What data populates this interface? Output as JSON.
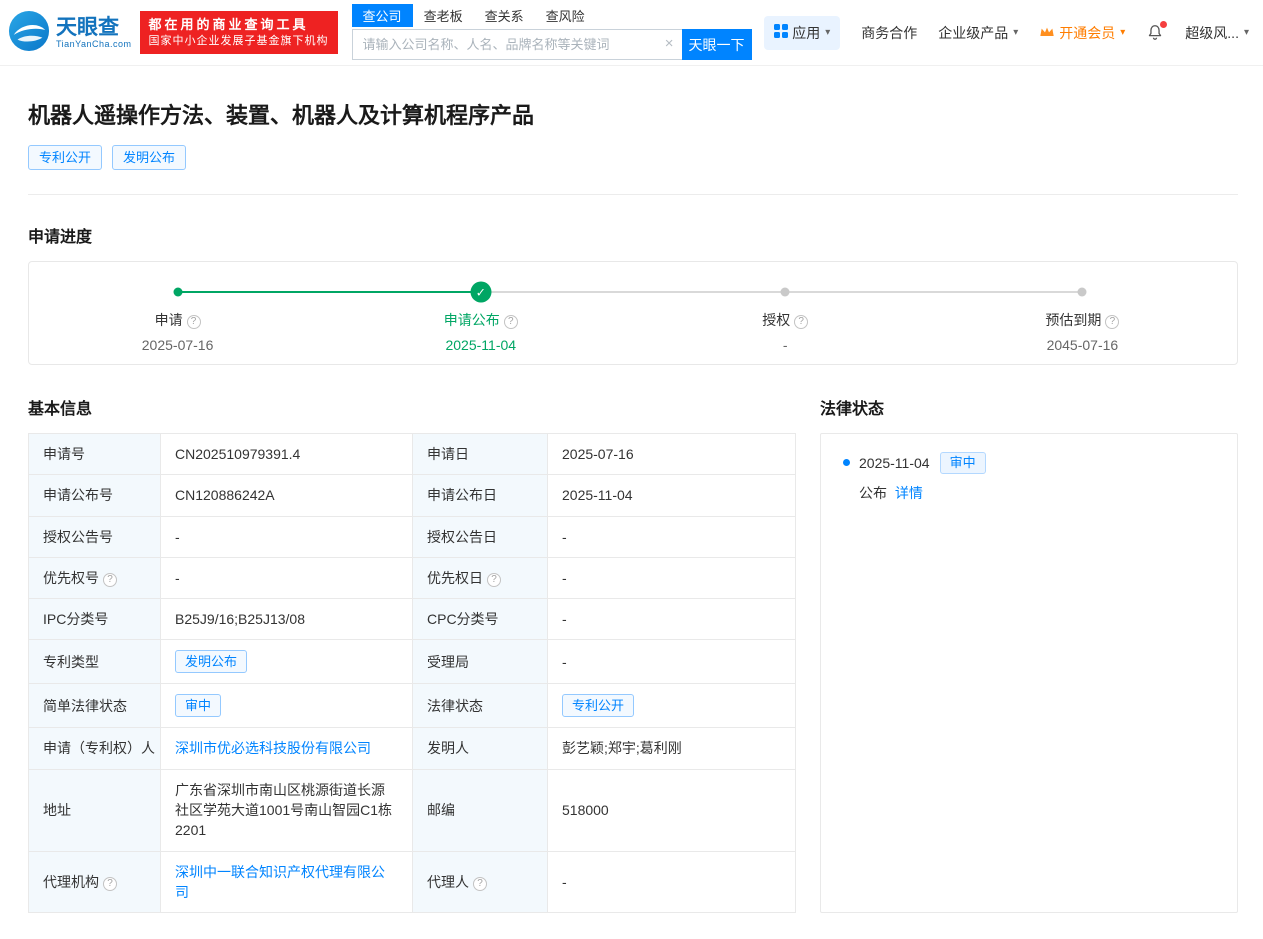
{
  "colors": {
    "brand_blue": "#0084ff",
    "green": "#00a664",
    "orange": "#ff7d00",
    "badge_red": "#ee2222"
  },
  "icons": {
    "help": "?",
    "caret_down": "▾",
    "check": "✓",
    "close": "×"
  },
  "header": {
    "logo_cn": "天眼查",
    "logo_en": "TianYanCha.com",
    "badge_line1": "都在用的商业查询工具",
    "badge_line2": "国家中小企业发展子基金旗下机构",
    "nav_tabs": [
      {
        "label": "查公司"
      },
      {
        "label": "查老板"
      },
      {
        "label": "查关系"
      },
      {
        "label": "查风险"
      }
    ],
    "search_placeholder": "请输入公司名称、人名、品牌名称等关键词",
    "search_button": "天眼一下",
    "menu_apps": "应用",
    "menu_biz": "商务合作",
    "menu_enterprise": "企业级产品",
    "menu_vip": "开通会员",
    "menu_super": "超级风..."
  },
  "page": {
    "title": "机器人遥操作方法、装置、机器人及计算机程序产品",
    "tags": [
      "专利公开",
      "发明公布"
    ]
  },
  "progress": {
    "section_title": "申请进度",
    "steps": [
      {
        "label": "申请",
        "date": "2025-07-16"
      },
      {
        "label": "申请公布",
        "date": "2025-11-04"
      },
      {
        "label": "授权",
        "date": "-"
      },
      {
        "label": "预估到期",
        "date": "2045-07-16"
      }
    ]
  },
  "basic_info": {
    "section_title": "基本信息",
    "rows": [
      {
        "l1": "申请号",
        "v1": "CN202510979391.4",
        "l2": "申请日",
        "v2": "2025-07-16"
      },
      {
        "l1": "申请公布号",
        "v1": "CN120886242A",
        "l2": "申请公布日",
        "v2": "2025-11-04"
      },
      {
        "l1": "授权公告号",
        "v1": "-",
        "l2": "授权公告日",
        "v2": "-"
      },
      {
        "l1": "优先权号",
        "v1": "-",
        "l2": "优先权日",
        "v2": "-"
      },
      {
        "l1": "IPC分类号",
        "v1": "B25J9/16;B25J13/08",
        "l2": "CPC分类号",
        "v2": "-"
      },
      {
        "l1": "专利类型",
        "v1": "发明公布",
        "l2": "受理局",
        "v2": "-"
      },
      {
        "l1": "简单法律状态",
        "v1": "审中",
        "l2": "法律状态",
        "v2": "专利公开"
      },
      {
        "l1": "申请（专利权）人",
        "v1": "深圳市优必选科技股份有限公司",
        "l2": "发明人",
        "v2": "彭艺颖;郑宇;葛利刚"
      },
      {
        "l1": "地址",
        "v1": "广东省深圳市南山区桃源街道长源社区学苑大道1001号南山智园C1栋2201",
        "l2": "邮编",
        "v2": "518000"
      },
      {
        "l1": "代理机构",
        "v1": "深圳中一联合知识产权代理有限公司",
        "l2": "代理人",
        "v2": "-"
      }
    ]
  },
  "legal_status": {
    "section_title": "法律状态",
    "items": [
      {
        "date": "2025-11-04",
        "tag": "审中",
        "action": "公布",
        "detail_link": "详情"
      }
    ]
  }
}
